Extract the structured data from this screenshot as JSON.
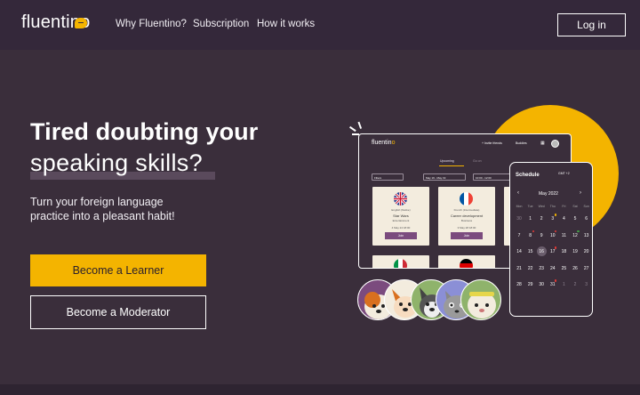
{
  "header": {
    "logo_text": "fluentino",
    "nav": [
      "Why Fluentino?",
      "Subscription",
      "How it works"
    ],
    "login_label": "Log in"
  },
  "hero": {
    "title_line1": "Tired doubting your",
    "title_line2": "speaking skills?",
    "subtitle": "Turn your foreign language practice into a pleasant habit!",
    "learner_label": "Become a Learner",
    "moderator_label": "Become a Moderator"
  },
  "illustration": {
    "laptop": {
      "logo": "fluentin",
      "logo_accent": "o",
      "invite_link": "+ Invite friends",
      "buddies_link": "Buddies",
      "tabs": [
        "Upcoming",
        "Go on"
      ],
      "filters": [
        "Filters",
        "May 19 - May 19",
        "10:00 - 12:00"
      ],
      "cards": [
        {
          "language": "English (Native)",
          "topic": "Star Wars",
          "category": "Entertainment",
          "meta": "4   May 24   18:00",
          "join": "Join"
        },
        {
          "language": "French (Intermediate)",
          "topic": "Career development",
          "category": "Business",
          "meta": "3   May 28   18:00",
          "join": "Join"
        }
      ]
    },
    "phone": {
      "title": "Schedule",
      "timezone": "GMT +2",
      "month": "May 2022",
      "weekdays": [
        "Mon",
        "Tue",
        "Wed",
        "Thu",
        "Fri",
        "Sat",
        "Sun"
      ],
      "weeks": [
        [
          "30",
          "1",
          "2",
          "3",
          "4",
          "5",
          "6"
        ],
        [
          "7",
          "8",
          "9",
          "10",
          "11",
          "12",
          "13"
        ],
        [
          "14",
          "15",
          "16",
          "17",
          "18",
          "19",
          "20"
        ],
        [
          "21",
          "22",
          "23",
          "24",
          "25",
          "26",
          "27"
        ],
        [
          "28",
          "29",
          "30",
          "31",
          "1",
          "2",
          "3"
        ]
      ],
      "selected_day": "16"
    }
  },
  "colors": {
    "background": "#3a2e3b",
    "header": "#34283a",
    "accent": "#f4b400",
    "join_button": "#7b4b7e"
  }
}
